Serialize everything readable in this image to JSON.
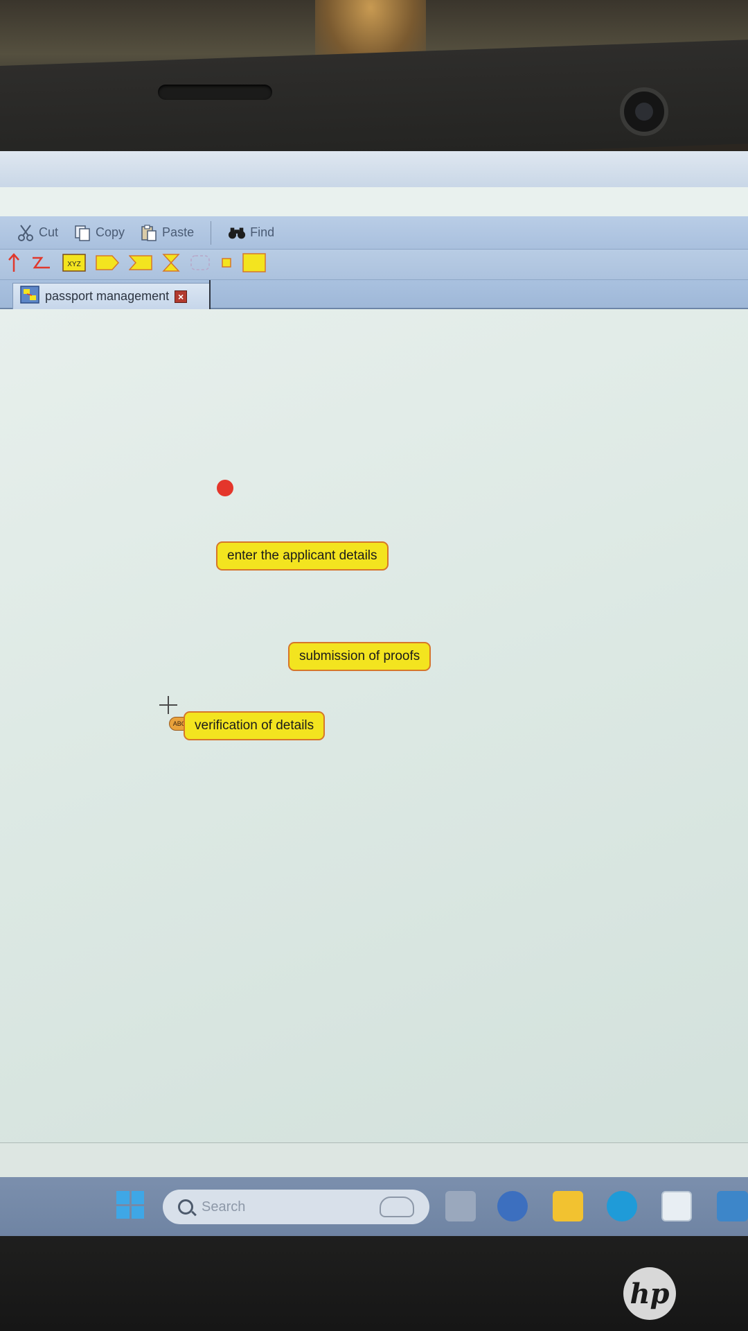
{
  "toolbar": {
    "cut_label": "Cut",
    "copy_label": "Copy",
    "paste_label": "Paste",
    "find_label": "Find",
    "icons": [
      "scissors-icon",
      "copy-icon",
      "paste-icon",
      "binoculars-icon"
    ]
  },
  "palette": {
    "tools": [
      "arrow-up-icon",
      "transition-icon",
      "object-node-icon",
      "send-signal-icon",
      "accept-event-icon",
      "hourglass-icon",
      "region-icon",
      "small-node-icon",
      "action-icon"
    ]
  },
  "tab": {
    "label": "passport management",
    "close_glyph": "×"
  },
  "diagram": {
    "nodes": [
      {
        "label": "enter the applicant details"
      },
      {
        "label": "submission of proofs"
      },
      {
        "label": "verification of details"
      }
    ],
    "badge": "ABC"
  },
  "taskbar": {
    "search_placeholder": "Search"
  },
  "brand": {
    "logo_text": "hp"
  },
  "colors": {
    "action_fill": "#f3e41f",
    "action_border": "#d6762a",
    "start_node": "#e4362b",
    "toolbar": "#a9c0de"
  }
}
